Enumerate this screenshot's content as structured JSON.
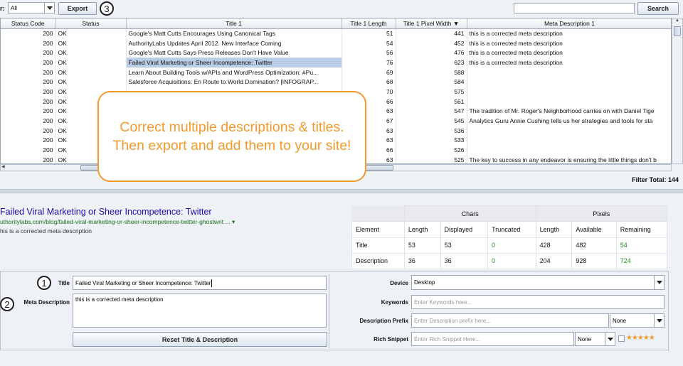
{
  "toolbar": {
    "filter_label": "r:",
    "filter_value": "All",
    "export_label": "Export",
    "search_placeholder": "",
    "search_label": "Search",
    "step3": "3"
  },
  "grid": {
    "columns": [
      "Status Code",
      "Status",
      "Title 1",
      "Title 1 Length",
      "Title 1 Pixel Width",
      "Meta Description 1"
    ],
    "rows": [
      {
        "code": "200",
        "status": "OK",
        "title": "Google's Matt Cutts Encourages Using Canonical Tags",
        "len": "51",
        "px": "441",
        "meta": "this is a corrected meta description"
      },
      {
        "code": "200",
        "status": "OK",
        "title": "AuthorityLabs Updates April 2012. New Interface Coming",
        "len": "54",
        "px": "452",
        "meta": "this is a corrected meta description"
      },
      {
        "code": "200",
        "status": "OK",
        "title": "Google's Matt Cutts Says Press Releases Don't Have Value",
        "len": "56",
        "px": "476",
        "meta": "this is a corrected meta description"
      },
      {
        "code": "200",
        "status": "OK",
        "title": "Failed Viral Marketing or Sheer Incompetence: Twitter",
        "len": "76",
        "px": "623",
        "meta": "this is a corrected meta description"
      },
      {
        "code": "200",
        "status": "OK",
        "title": "Learn About Building Tools w/APIs and WordPress Optimization: #Pu...",
        "len": "69",
        "px": "588",
        "meta": ""
      },
      {
        "code": "200",
        "status": "OK",
        "title": "Salesforce Acquisitions: En Route to World Domination? [INFOGRAP...",
        "len": "68",
        "px": "584",
        "meta": ""
      },
      {
        "code": "200",
        "status": "OK",
        "title": "",
        "len": "70",
        "px": "575",
        "meta": ""
      },
      {
        "code": "200",
        "status": "OK",
        "title": "",
        "len": "66",
        "px": "561",
        "meta": ""
      },
      {
        "code": "200",
        "status": "OK",
        "title": "",
        "len": "63",
        "px": "547",
        "meta": "The tradition of Mr. Roger's Neighborhood carries on with Daniel Tige"
      },
      {
        "code": "200",
        "status": "OK",
        "title": "",
        "len": "67",
        "px": "545",
        "meta": "Analytics Guru Annie Cushing tells us her strategies and tools for sta"
      },
      {
        "code": "200",
        "status": "OK",
        "title": "",
        "len": "63",
        "px": "536",
        "meta": ""
      },
      {
        "code": "200",
        "status": "OK",
        "title": "",
        "len": "63",
        "px": "533",
        "meta": ""
      },
      {
        "code": "200",
        "status": "OK",
        "title": "",
        "len": "66",
        "px": "526",
        "meta": ""
      },
      {
        "code": "200",
        "status": "OK",
        "title": "",
        "len": "63",
        "px": "525",
        "meta": "The key to success in any endeavor is ensuring the little things don't b"
      }
    ],
    "selected_row": 3,
    "filter_total_label": "Filter Total:",
    "filter_total_value": "144"
  },
  "callout": {
    "text": "Correct multiple descriptions & titles. Then export and add them to your site!"
  },
  "serp": {
    "title": "Failed Viral Marketing or Sheer Incompetence: Twitter",
    "url": "uthoritylabs.com/blog/failed-viral-marketing-or-sheer-incompetence-twitter-ghostwrit ...",
    "url_arrow": "▾",
    "description": "his is a corrected meta description"
  },
  "stats": {
    "group_chars": "Chars",
    "group_pixels": "Pixels",
    "headers": [
      "Element",
      "Length",
      "Displayed",
      "Truncated",
      "Length",
      "Available",
      "Remaining"
    ],
    "rows": [
      {
        "element": "Title",
        "length": "53",
        "displayed": "53",
        "truncated": "0",
        "px_length": "428",
        "available": "482",
        "remaining": "54"
      },
      {
        "element": "Description",
        "length": "36",
        "displayed": "36",
        "truncated": "0",
        "px_length": "204",
        "available": "928",
        "remaining": "724"
      }
    ]
  },
  "editor": {
    "step1": "1",
    "step2": "2",
    "title_label": "Title",
    "title_value": "Failed Viral Marketing or Sheer Incompetence: Twitter",
    "meta_label": "Meta Description",
    "meta_value": "this is a corrected meta description",
    "reset_label": "Reset Title & Description",
    "device_label": "Device",
    "device_value": "Desktop",
    "keywords_label": "Keywords",
    "keywords_placeholder": "Enter Keywords here...",
    "prefix_label": "Description Prefix",
    "prefix_placeholder": "Enter Description prefix here...",
    "prefix_select": "None",
    "rich_label": "Rich Snippet",
    "rich_placeholder": "Enter Rich Snippet Here...",
    "rich_select": "None",
    "stars": "★★★★★"
  },
  "colors": {
    "accent_orange": "#f39a2c",
    "link_blue": "#1a0dab",
    "url_green": "#197019",
    "selection": "#b9cde6"
  }
}
